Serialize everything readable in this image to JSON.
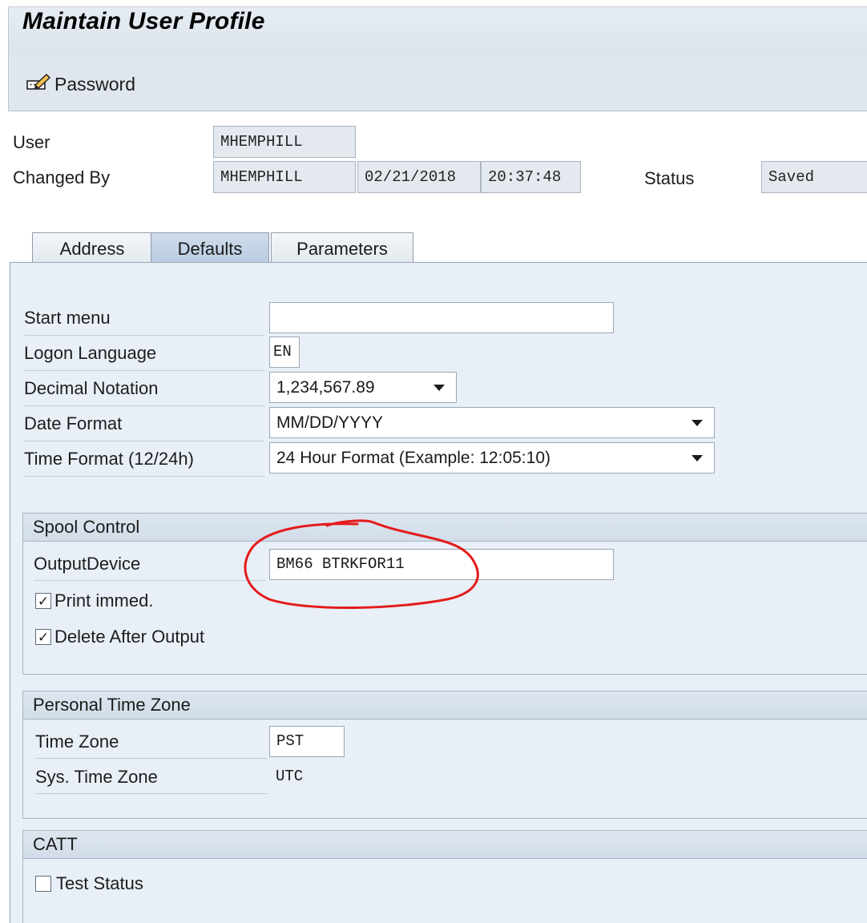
{
  "window": {
    "title": "Maintain User Profile"
  },
  "toolbar": {
    "password_label": "Password"
  },
  "header": {
    "user_label": "User",
    "user_value": "MHEMPHILL",
    "changed_by_label": "Changed By",
    "changed_by_value": "MHEMPHILL",
    "changed_date": "02/21/2018",
    "changed_time": "20:37:48",
    "status_label": "Status",
    "status_value": "Saved"
  },
  "tabs": [
    {
      "label": "Address"
    },
    {
      "label": "Defaults"
    },
    {
      "label": "Parameters"
    }
  ],
  "defaults": {
    "start_menu_label": "Start menu",
    "start_menu_value": "",
    "logon_language_label": "Logon Language",
    "logon_language_value": "EN",
    "decimal_notation_label": "Decimal Notation",
    "decimal_notation_value": "1,234,567.89",
    "date_format_label": "Date Format",
    "date_format_value": "MM/DD/YYYY",
    "time_format_label": "Time Format (12/24h)",
    "time_format_value": "24 Hour Format (Example: 12:05:10)"
  },
  "spool": {
    "title": "Spool Control",
    "output_device_label": "OutputDevice",
    "output_device_value": "BM66 BTRKFOR11",
    "print_immed_label": "Print immed.",
    "print_immed_checked": true,
    "delete_after_output_label": "Delete After Output",
    "delete_after_output_checked": true
  },
  "timezone": {
    "title": "Personal Time Zone",
    "time_zone_label": "Time Zone",
    "time_zone_value": "PST",
    "sys_time_zone_label": "Sys. Time Zone",
    "sys_time_zone_value": "UTC"
  },
  "catt": {
    "title": "CATT",
    "test_status_label": "Test Status",
    "test_status_checked": false
  },
  "colors": {
    "annotation_circle": "#e31b1b",
    "panel_bg": "#e8eff6",
    "active_tab": "#bfd0e3"
  }
}
